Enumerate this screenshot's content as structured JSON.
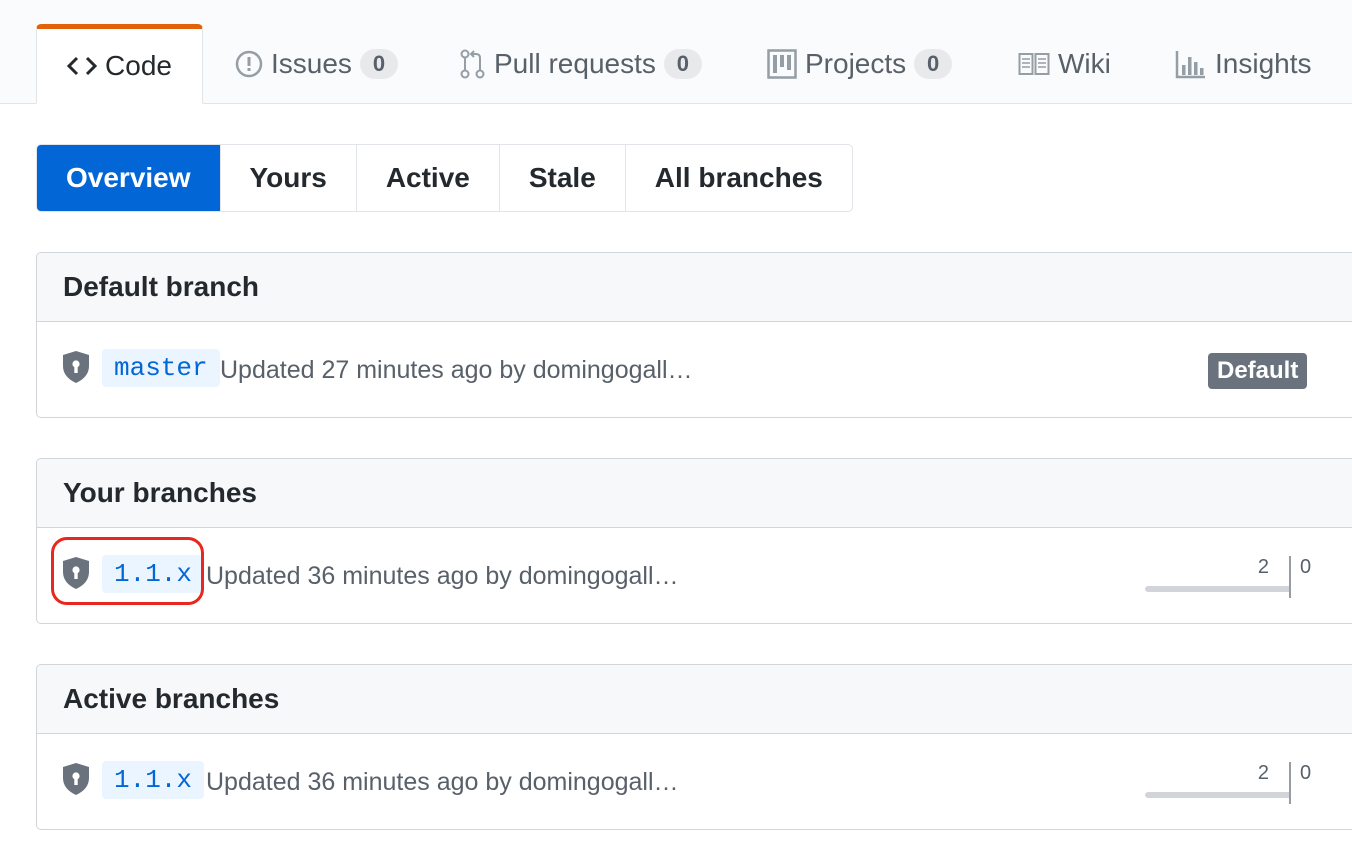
{
  "reponav": {
    "tabs": [
      {
        "label": "Code",
        "icon": "code-icon",
        "selected": true
      },
      {
        "label": "Issues",
        "icon": "issue-icon",
        "counter": "0"
      },
      {
        "label": "Pull requests",
        "icon": "pull-request-icon",
        "counter": "0"
      },
      {
        "label": "Projects",
        "icon": "project-icon",
        "counter": "0"
      },
      {
        "label": "Wiki",
        "icon": "book-icon"
      },
      {
        "label": "Insights",
        "icon": "graph-icon"
      }
    ]
  },
  "subnav": {
    "items": [
      "Overview",
      "Yours",
      "Active",
      "Stale",
      "All branches"
    ],
    "selected": "Overview"
  },
  "default_section": {
    "title": "Default branch",
    "branch": "master",
    "updated": "Updated 27 minutes ago by domingogall…",
    "badge": "Default"
  },
  "yours_section": {
    "title": "Your branches",
    "branch": "1.1.x",
    "updated": "Updated 36 minutes ago by domingogall…",
    "behind": "2",
    "ahead": "0"
  },
  "active_section": {
    "title": "Active branches",
    "branch": "1.1.x",
    "updated": "Updated 36 minutes ago by domingogall…",
    "behind": "2",
    "ahead": "0"
  },
  "colors": {
    "accent": "#0366d6",
    "tab_highlight": "#e36209",
    "annotation": "#e8271f"
  }
}
